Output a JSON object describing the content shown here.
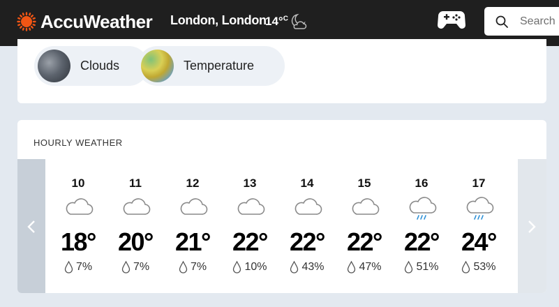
{
  "header": {
    "brand": "AccuWeather",
    "location": "London, London",
    "temp": "14°",
    "temp_unit": "C",
    "search_placeholder": "Search"
  },
  "maps": [
    {
      "label": "Clouds",
      "icon": "clouds-map-thumbnail"
    },
    {
      "label": "Temperature",
      "icon": "temperature-map-thumbnail"
    }
  ],
  "hourly": {
    "title": "HOURLY WEATHER",
    "hours": [
      {
        "time": "10",
        "temp": "18°",
        "precip": "7%",
        "icon": "cloud-icon"
      },
      {
        "time": "11",
        "temp": "20°",
        "precip": "7%",
        "icon": "cloud-icon"
      },
      {
        "time": "12",
        "temp": "21°",
        "precip": "7%",
        "icon": "cloud-icon"
      },
      {
        "time": "13",
        "temp": "22°",
        "precip": "10%",
        "icon": "cloud-icon"
      },
      {
        "time": "14",
        "temp": "22°",
        "precip": "43%",
        "icon": "cloud-icon"
      },
      {
        "time": "15",
        "temp": "22°",
        "precip": "47%",
        "icon": "cloud-icon"
      },
      {
        "time": "16",
        "temp": "22°",
        "precip": "51%",
        "icon": "rain-cloud-icon"
      },
      {
        "time": "17",
        "temp": "24°",
        "precip": "53%",
        "icon": "rain-cloud-icon"
      }
    ]
  },
  "colors": {
    "header_bg": "#1f1f1f",
    "brand_orange": "#f05514",
    "page_bg": "#e3e9f0"
  }
}
